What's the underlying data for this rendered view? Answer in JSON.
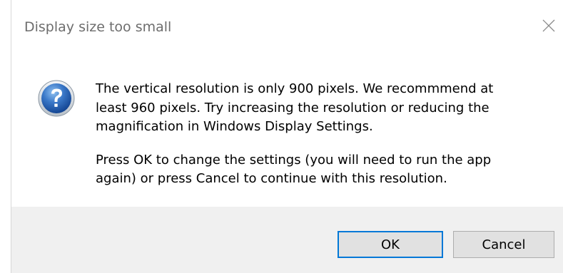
{
  "dialog": {
    "title": "Display size too small",
    "close_icon": "close-icon",
    "message_icon": "question-icon",
    "message_paragraph_1": "The vertical resolution is only 900 pixels.  We recommmend at\nleast 960 pixels.  Try increasing the resolution or reducing the\nmagnification in Windows Display Settings.",
    "message_paragraph_2": "Press OK to change the settings (you will need to run the app\nagain) or press Cancel to continue with this resolution.",
    "ok_label": "OK",
    "cancel_label": "Cancel"
  },
  "colors": {
    "accent": "#0078d7",
    "footer_bg": "#f0f0f0",
    "button_bg": "#e1e1e1",
    "title_text": "#6d6d6d"
  }
}
